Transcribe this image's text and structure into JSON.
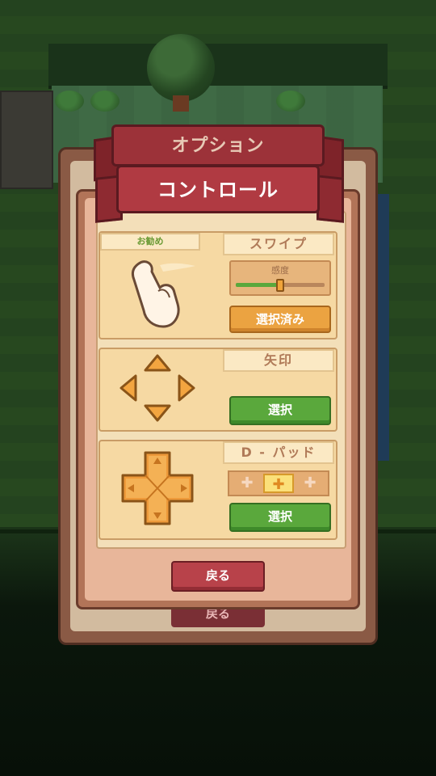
{
  "back_panel": {
    "title": "オプション",
    "back_label": "戻る"
  },
  "controls_panel": {
    "title": "コントロール",
    "swipe": {
      "badge": "お勧め",
      "label": "スワイプ",
      "sensitivity_label": "感度",
      "sensitivity_level": 0.5,
      "button": "選択済み"
    },
    "arrows": {
      "label": "矢印",
      "button": "選択"
    },
    "dpad": {
      "label": "D - パッド",
      "button": "選択",
      "size_options": [
        "✚",
        "✚",
        "✚"
      ],
      "selected_option": 1
    },
    "back_button": "戻る"
  },
  "colors": {
    "ribbon": "#9c3239",
    "green_button": "#5aa83c",
    "orange_button": "#eba341",
    "red_button": "#b8424a"
  }
}
